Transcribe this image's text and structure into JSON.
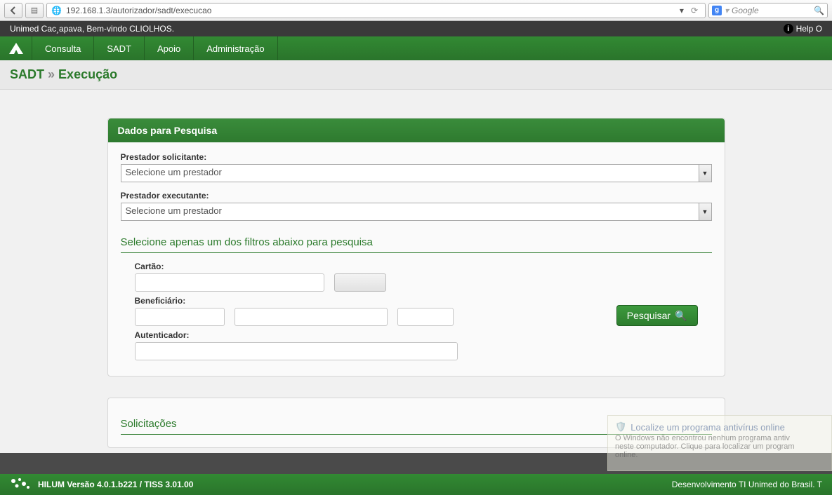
{
  "browser": {
    "url": "192.168.1.3/autorizador/sadt/execucao",
    "search_placeholder": "Google"
  },
  "topstrip": {
    "welcome": "Unimed Cac¸apava, Bem-vindo CLIOLHOS.",
    "help": "Help O"
  },
  "nav": {
    "items": [
      "Consulta",
      "SADT",
      "Apoio",
      "Administração"
    ]
  },
  "breadcrumb": {
    "a": "SADT",
    "sep": "»",
    "b": "Execução"
  },
  "panel": {
    "title": "Dados para Pesquisa",
    "label_solicitante": "Prestador solicitante:",
    "label_executante": "Prestador executante:",
    "select_placeholder": "Selecione um prestador",
    "filters_title": "Selecione apenas um dos filtros abaixo para pesquisa",
    "label_cartao": "Cartão:",
    "label_benef": "Beneficiário:",
    "label_auth": "Autenticador:",
    "search_btn": "Pesquisar"
  },
  "panel2": {
    "title": "Solicitações"
  },
  "popup": {
    "title": "Localize um programa antivírus online",
    "line1": "O Windows não encontrou nenhum programa antiv",
    "line2": "neste computador. Clique para localizar um program",
    "line3": "online."
  },
  "footer": {
    "version": "HILUM Versão 4.0.1.b221 / TISS 3.01.00",
    "dev": "Desenvolvimento TI Unimed do Brasil. T"
  }
}
